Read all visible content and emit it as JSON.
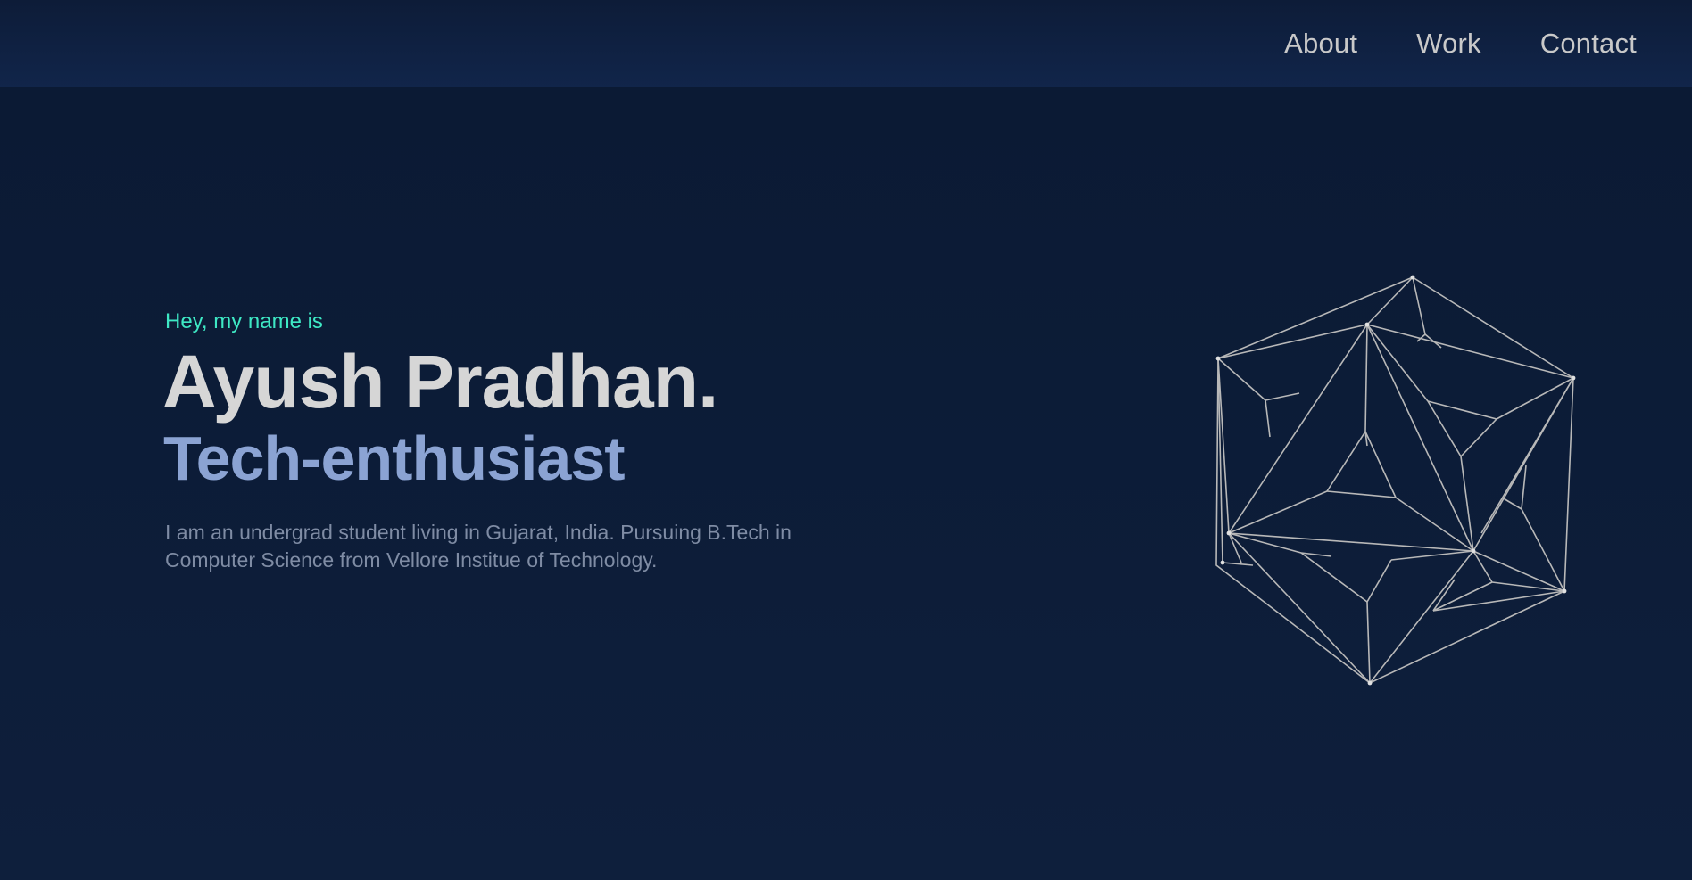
{
  "nav": {
    "items": [
      {
        "label": "About"
      },
      {
        "label": "Work"
      },
      {
        "label": "Contact"
      }
    ]
  },
  "hero": {
    "greeting": "Hey, my name is",
    "name": "Ayush Pradhan.",
    "tagline": "Tech-enthusiast",
    "bio": "I am an undergrad student living in Gujarat, India. Pursuing B.Tech in Computer Science from Vellore Institue of Technology."
  },
  "colors": {
    "background": "#0b1a33",
    "navbar": "#11254a",
    "accent": "#3ee8c4",
    "name": "#d6d6d6",
    "tagline": "#8ba3d3",
    "bio": "#7f8ca4",
    "wireframe": "#b8b8b8"
  },
  "illustration": {
    "icon": "polyhedron-wireframe-icon"
  }
}
